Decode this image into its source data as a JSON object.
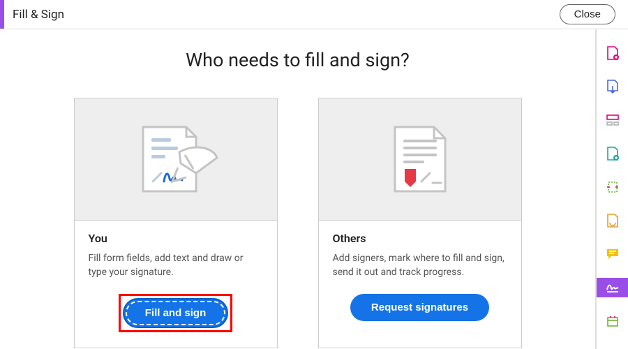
{
  "topbar": {
    "title": "Fill & Sign",
    "close_label": "Close"
  },
  "main": {
    "headline": "Who needs to fill and sign?",
    "cards": {
      "you": {
        "title": "You",
        "desc": "Fill form fields, add text and draw or type your signature.",
        "button": "Fill and sign"
      },
      "others": {
        "title": "Others",
        "desc": "Add signers, mark where to fill and sign, send it out and track progress.",
        "button": "Request signatures"
      }
    }
  }
}
